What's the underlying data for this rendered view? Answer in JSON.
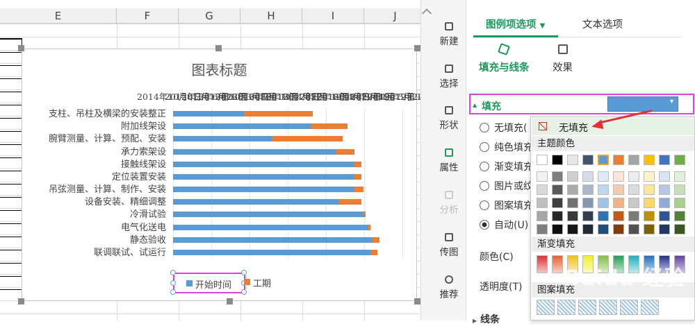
{
  "sheet": {
    "columns": [
      "E",
      "F",
      "G",
      "H",
      "I",
      "J"
    ]
  },
  "chart": {
    "title": "图表标题",
    "top_axis_text": [
      "2014年",
      "2015年",
      "2016年",
      "2016年",
      "2017年",
      "2017年",
      "2018年",
      "2019年",
      "2019年",
      "2015年"
    ],
    "top_axis_raw": "2014年10月5日 2015年2月12日 2015年6月22日 2015年10月30日 2016年3月8日 2016年7月16日 2016年11月23日 2017年4月2日 2017年8月10日 2017年12月18日 2018年4月27日 2018年9月4日 2019年1月12日 2019年5月22日 2019年9月29日",
    "legend": [
      "开始时间",
      "工期"
    ]
  },
  "chart_data": {
    "type": "bar",
    "orientation": "horizontal-stacked-gantt",
    "title": "图表标题",
    "categories": [
      "支柱、吊柱及横梁的安装整正",
      "附加线架设",
      "腕臂测量、计算、预配、安装",
      "承力索架设",
      "接触线架设",
      "定位装置安装",
      "吊弦测量、计算、制作、安装",
      "设备安装、精细调整",
      "冷滑试验",
      "电气化送电",
      "静态验收",
      "联调联试、试运行"
    ],
    "series": [
      {
        "name": "开始时间",
        "color": "#5b9bd5",
        "values": [
          0.31,
          0.6,
          0.43,
          0.71,
          0.79,
          0.79,
          0.79,
          0.72,
          0.83,
          0.85,
          0.87,
          0.86
        ]
      },
      {
        "name": "工期",
        "color": "#ed7d31",
        "values": [
          0.3,
          0.16,
          0.31,
          0.08,
          0.03,
          0.03,
          0.04,
          0.1,
          0.01,
          0.01,
          0.03,
          0.03
        ]
      }
    ],
    "legend_position": "bottom",
    "grid": true
  },
  "toolbar": {
    "items": [
      {
        "label": "新建",
        "disabled": false
      },
      {
        "label": "选择",
        "disabled": false
      },
      {
        "label": "形状",
        "disabled": false
      },
      {
        "label": "属性",
        "disabled": false
      },
      {
        "label": "分析",
        "disabled": true
      },
      {
        "label": "传图",
        "disabled": false
      },
      {
        "label": "推荐",
        "disabled": false
      }
    ]
  },
  "panel": {
    "tab_active": "图例项选项",
    "tab_other": "文本选项",
    "sub_active": "填充与线条",
    "sub_other": "效果",
    "fill_header": "填充",
    "options": [
      "无填充(",
      "纯色填充",
      "渐变填充",
      "图片或纹",
      "图案填充",
      "自动(U)"
    ],
    "color_label": "颜色(C)",
    "opacity_label": "透明度(T)",
    "line_label": "线条"
  },
  "popup": {
    "no_fill": "无填充",
    "theme_colors": "主题颜色",
    "gradient": "渐变填充",
    "pattern": "图案填充",
    "watermark": "Baidu 经验"
  }
}
